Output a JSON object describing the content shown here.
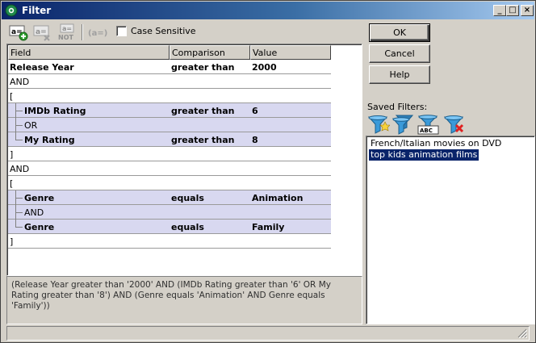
{
  "window": {
    "title": "Filter"
  },
  "toolbar": {
    "add_icon": "add-condition-icon",
    "add_text": "a=",
    "remove_text": "a=",
    "not_text": "a=",
    "not_label": "NOT",
    "group_text": "(a=)"
  },
  "options": {
    "case_sensitive_label": "Case Sensitive",
    "case_sensitive_checked": false
  },
  "grid": {
    "headers": [
      "Field",
      "Comparison",
      "Value"
    ],
    "rows": [
      {
        "field": "Release Year",
        "comparison": "greater than",
        "value": "2000",
        "highlight": false,
        "indent": 0,
        "bold": true
      },
      {
        "field": "AND",
        "comparison": "",
        "value": "",
        "highlight": false,
        "indent": 0,
        "bold": false
      },
      {
        "field": "[",
        "comparison": "",
        "value": "",
        "highlight": false,
        "indent": 0,
        "bold": false
      },
      {
        "field": "IMDb Rating",
        "comparison": "greater than",
        "value": "6",
        "highlight": true,
        "indent": 1,
        "bold": true
      },
      {
        "field": "OR",
        "comparison": "",
        "value": "",
        "highlight": true,
        "indent": 1,
        "bold": false
      },
      {
        "field": "My Rating",
        "comparison": "greater than",
        "value": "8",
        "highlight": true,
        "indent": 1,
        "bold": true
      },
      {
        "field": "]",
        "comparison": "",
        "value": "",
        "highlight": false,
        "indent": 0,
        "bold": false
      },
      {
        "field": "AND",
        "comparison": "",
        "value": "",
        "highlight": false,
        "indent": 0,
        "bold": false
      },
      {
        "field": "[",
        "comparison": "",
        "value": "",
        "highlight": false,
        "indent": 0,
        "bold": false
      },
      {
        "field": "Genre",
        "comparison": "equals",
        "value": "Animation",
        "highlight": true,
        "indent": 1,
        "bold": true
      },
      {
        "field": "AND",
        "comparison": "",
        "value": "",
        "highlight": true,
        "indent": 1,
        "bold": false
      },
      {
        "field": "Genre",
        "comparison": "equals",
        "value": "Family",
        "highlight": true,
        "indent": 1,
        "bold": true
      },
      {
        "field": "]",
        "comparison": "",
        "value": "",
        "highlight": false,
        "indent": 0,
        "bold": false
      }
    ]
  },
  "description": "(Release Year greater than '2000' AND (IMDb Rating greater than '6' OR My Rating greater than '8') AND (Genre equals 'Animation' AND Genre equals 'Family'))",
  "buttons": {
    "ok": "OK",
    "cancel": "Cancel",
    "help": "Help"
  },
  "saved_filters": {
    "label": "Saved Filters:",
    "abc_text": "ABC",
    "items": [
      {
        "label": "French/Italian movies on DVD",
        "selected": false
      },
      {
        "label": "top kids animation films",
        "selected": true
      }
    ]
  },
  "colors": {
    "title_start": "#0a246a",
    "title_end": "#a6caf0",
    "highlight_row": "#d8d8f0",
    "selection": "#0a246a"
  }
}
